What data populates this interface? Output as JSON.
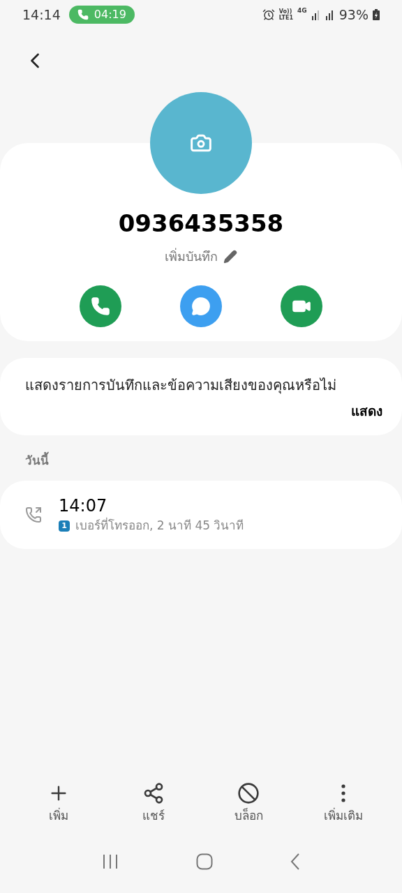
{
  "status_bar": {
    "time": "14:14",
    "call_timer": "04:19",
    "volte": "Vo))",
    "lte": "LTE1",
    "network": "4G",
    "battery": "93%"
  },
  "contact": {
    "number": "0936435358",
    "add_memo": "เพิ่มบันทึก"
  },
  "actions": [
    {
      "kind": "call"
    },
    {
      "kind": "message"
    },
    {
      "kind": "video"
    }
  ],
  "prompt": {
    "text": "แสดงรายการบันทึกและข้อความเสียงของคุณหรือไม่",
    "button": "แสดง"
  },
  "history": {
    "heading": "วันนี้",
    "calls": [
      {
        "time": "14:07",
        "sim": "1",
        "detail": "เบอร์ที่โทรออก, 2 นาที 45 วินาที"
      }
    ]
  },
  "toolbar": [
    {
      "kind": "add",
      "label": "เพิ่ม"
    },
    {
      "kind": "share",
      "label": "แชร์"
    },
    {
      "kind": "block",
      "label": "บล็อก"
    },
    {
      "kind": "more",
      "label": "เพิ่มเติม"
    }
  ]
}
